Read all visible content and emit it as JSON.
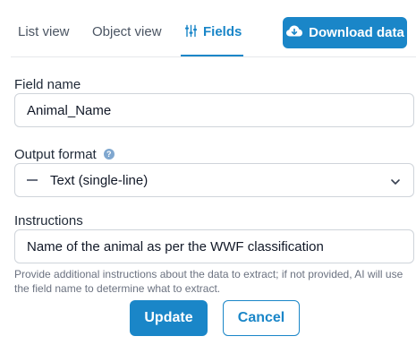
{
  "tabs": {
    "list_view": "List view",
    "object_view": "Object view",
    "fields": "Fields",
    "active": "fields"
  },
  "download_button": {
    "label": "Download data",
    "icon": "cloud-download-icon"
  },
  "field_name": {
    "label": "Field name",
    "value": "Animal_Name"
  },
  "output_format": {
    "label": "Output format",
    "help_icon": "help-icon",
    "value": "Text (single-line)"
  },
  "instructions": {
    "label": "Instructions",
    "value": "Name of the animal as per the WWF classification",
    "hint": "Provide additional instructions about the data to extract; if not provided, AI will use the field name to determine what to extract."
  },
  "actions": {
    "update": "Update",
    "cancel": "Cancel"
  },
  "colors": {
    "accent": "#1a86c8",
    "border": "#cfd4da",
    "text": "#1f2937",
    "muted": "#6b7280"
  }
}
